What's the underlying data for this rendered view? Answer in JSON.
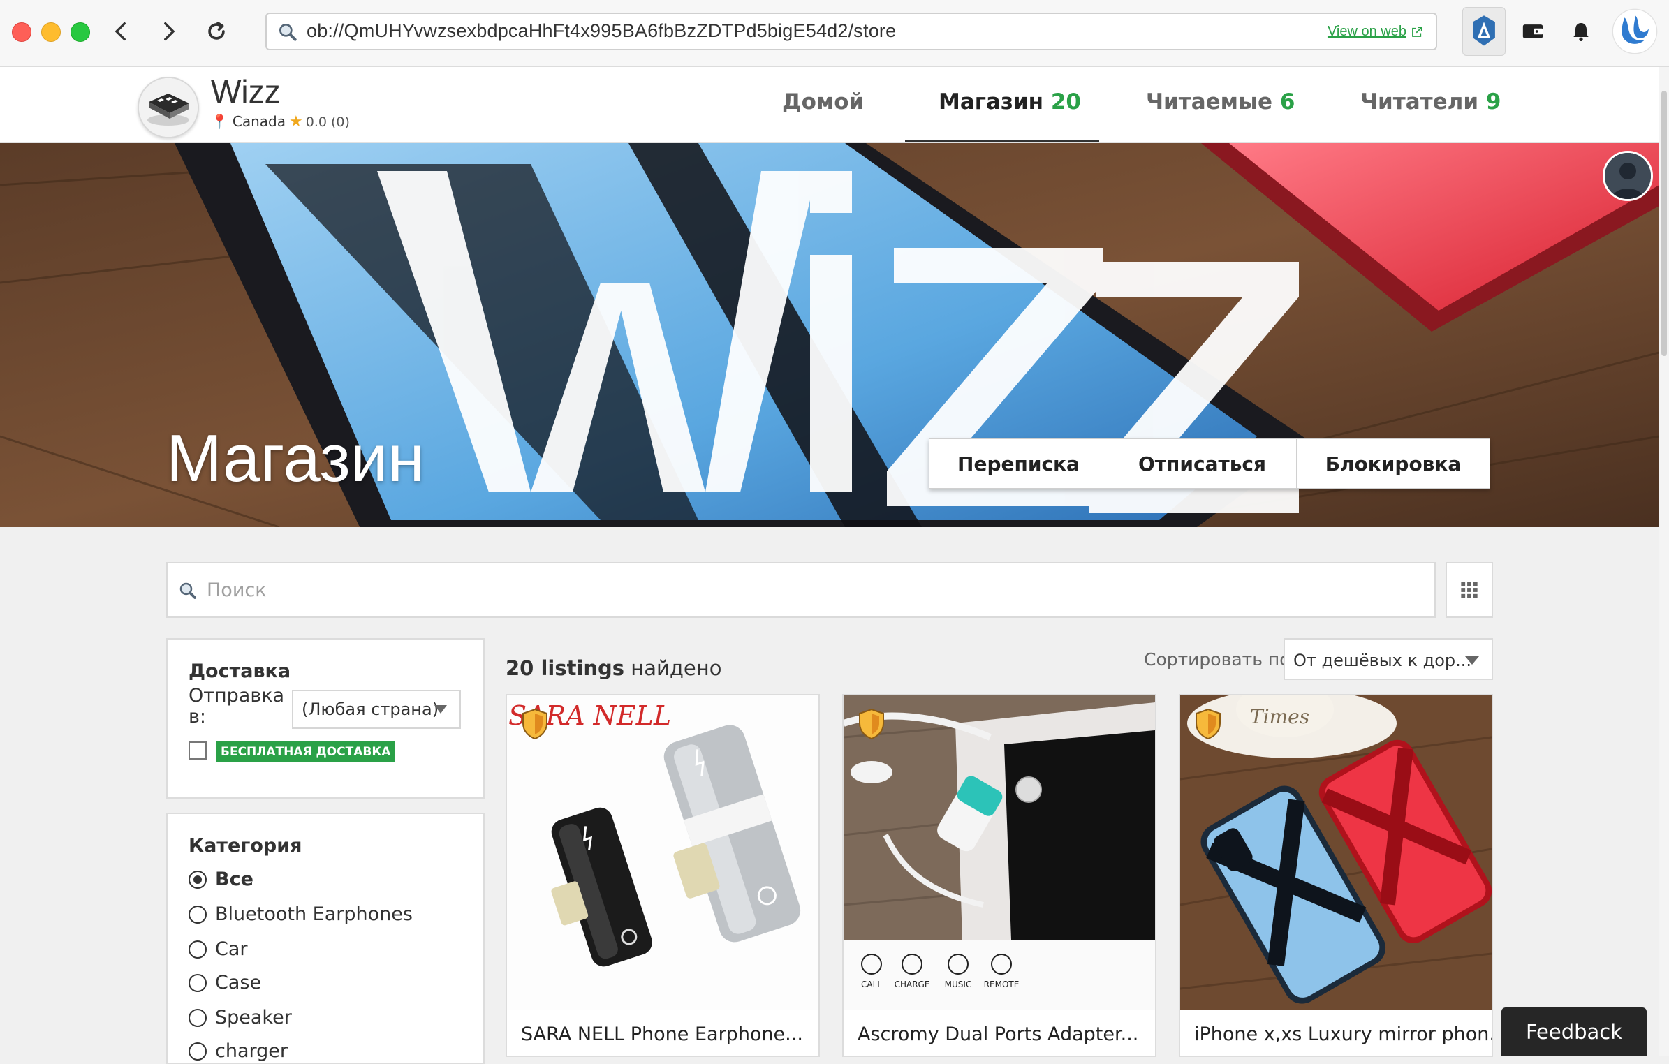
{
  "browser": {
    "url": "ob://QmUHYvwzsexbdpcaHhFt4x995BA6fbBzZDTPd5bigE54d2/store",
    "view_on_web": "View on web"
  },
  "store": {
    "name": "Wizz",
    "location": "Canada",
    "rating": "0.0 (0)"
  },
  "tabs": [
    {
      "label": "Домой",
      "count": ""
    },
    {
      "label": "Магазин",
      "count": "20"
    },
    {
      "label": "Читаемые",
      "count": "6"
    },
    {
      "label": "Читатели",
      "count": "9"
    }
  ],
  "hero": {
    "title": "Магазин",
    "buttons": [
      "Переписка",
      "Отписаться",
      "Блокировка"
    ]
  },
  "search": {
    "placeholder": "Поиск"
  },
  "shipping": {
    "title": "Доставка",
    "ship_label": "Отправка в:",
    "country": "(Любая страна)",
    "free_label": "БЕСПЛАТНАЯ ДОСТАВКА"
  },
  "category": {
    "title": "Категория",
    "items": [
      "Все",
      "Bluetooth Earphones",
      "Car",
      "Case",
      "Speaker",
      "charger"
    ],
    "selected": "Все"
  },
  "listings": {
    "count_bold": "20 listings",
    "count_rest": "найдено",
    "sort_label": "Сортировать по",
    "sort_value": "От дешёвых к дор...",
    "cards": [
      {
        "title": "SARA NELL Phone Earphone...",
        "brand": "SARA NELL"
      },
      {
        "title": "Ascromy Dual Ports Adapter...",
        "icons": [
          "CALL",
          "CHARGE",
          "MUSIC",
          "REMOTE"
        ]
      },
      {
        "title": "iPhone x,xs Luxury mirror phon...",
        "brand": "Times"
      }
    ]
  },
  "feedback": "Feedback",
  "colors": {
    "accent": "#2aa147",
    "star": "#f0a81e",
    "dark": "#262626"
  }
}
